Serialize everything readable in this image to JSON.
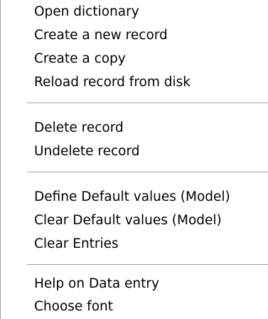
{
  "context_menu": {
    "group_file": {
      "open_dictionary": "Open dictionary",
      "create_new_record": "Create a new record",
      "create_copy": "Create a copy",
      "reload_record": "Reload record from disk"
    },
    "group_delete": {
      "delete_record": "Delete record",
      "undelete_record": "Undelete record"
    },
    "group_defaults": {
      "define_defaults": "Define Default values (Model)",
      "clear_defaults": "Clear Default values (Model)",
      "clear_entries": "Clear Entries"
    },
    "group_help": {
      "help_data_entry": "Help on Data entry",
      "choose_font": "Choose font"
    }
  }
}
